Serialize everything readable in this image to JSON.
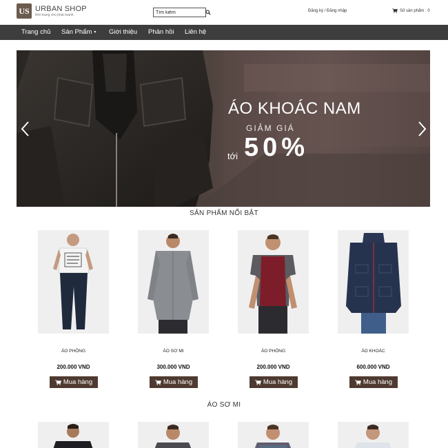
{
  "header": {
    "logo_mark": "US",
    "brand": "URBAN SHOP",
    "tagline": "thời trang cho phái mạnh",
    "search_placeholder": "Tìm kiếm",
    "auth": {
      "register": "Đăng ký",
      "separator": "/",
      "login": "Đăng nhập"
    },
    "cart_label": "Số sản phẩm : 0",
    "search_icon": "search-icon",
    "cart_icon": "cart-icon"
  },
  "nav": {
    "items": [
      {
        "label": "Trang chủ"
      },
      {
        "label": "Sản Phẩm",
        "dropdown": true
      },
      {
        "label": "Giới thiệu"
      },
      {
        "label": "Phản hồi"
      },
      {
        "label": "Liên hệ"
      }
    ]
  },
  "banner": {
    "title": "ÁO KHOÁC NAM",
    "subtitle": "GIẢM GIÁ",
    "prefix": "tới",
    "discount": "50%"
  },
  "featured": {
    "title": "SẢN PHẨM NỔI BẬT",
    "products": [
      {
        "name": "ÁO PHÔNG",
        "price": "200.000 VND",
        "buy_label": "Mua hàng"
      },
      {
        "name": "ÁO SƠ MI",
        "price": "300.000 VND",
        "buy_label": "Mua hàng"
      },
      {
        "name": "ÁO PHÔNG",
        "price": "200.000 VND",
        "buy_label": "Mua hàng"
      },
      {
        "name": "ÁO KHOÁC",
        "price": "600.000 VND",
        "buy_label": "Mua hàng"
      }
    ]
  },
  "shirts": {
    "title": "ÁO SƠ MI"
  },
  "colors": {
    "nav_bg": "#3d3d3d",
    "buy_button": "#4e3a30",
    "logo": "#6b5a4e"
  }
}
